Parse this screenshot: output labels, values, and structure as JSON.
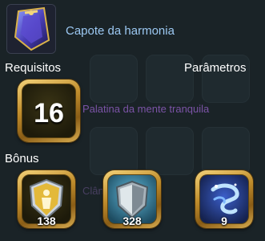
{
  "item": {
    "name": "Capote da harmonia",
    "icon": "cloak-icon"
  },
  "requirements": {
    "label": "Requisitos",
    "level": "16",
    "class_requirement": "Palatina da mente tranquila"
  },
  "parameters": {
    "label": "Parâmetros"
  },
  "bonuses": {
    "label": "Bônus",
    "items": [
      {
        "icon": "physical-defense-shield-icon",
        "value": "138"
      },
      {
        "icon": "magic-defense-shield-icon",
        "value": "328"
      },
      {
        "icon": "wind-evasion-icon",
        "value": "9"
      }
    ]
  }
}
